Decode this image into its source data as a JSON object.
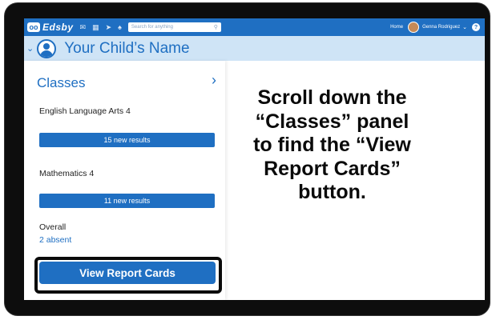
{
  "app": {
    "logo_text": "Edsby",
    "logo_mark": "oo",
    "search_placeholder": "Search for anything",
    "home_label": "Home",
    "user_name": "Genna Rodriguez"
  },
  "child_header": {
    "name": "Your Child’s Name"
  },
  "classes_panel": {
    "title": "Classes",
    "classes": [
      {
        "name": "English Language Arts 4",
        "results": "15 new results"
      },
      {
        "name": "Mathematics 4",
        "results": "11 new results"
      }
    ],
    "overall_label": "Overall",
    "overall_value": "2 absent",
    "report_button": "View Report Cards"
  },
  "instruction": {
    "text": "Scroll down the\n“Classes” panel\nto find the “View\nReport Cards”\nbutton."
  },
  "colors": {
    "brand_blue": "#1f6fc2",
    "child_bar": "#cfe4f6",
    "frame": "#0d0d0d"
  }
}
